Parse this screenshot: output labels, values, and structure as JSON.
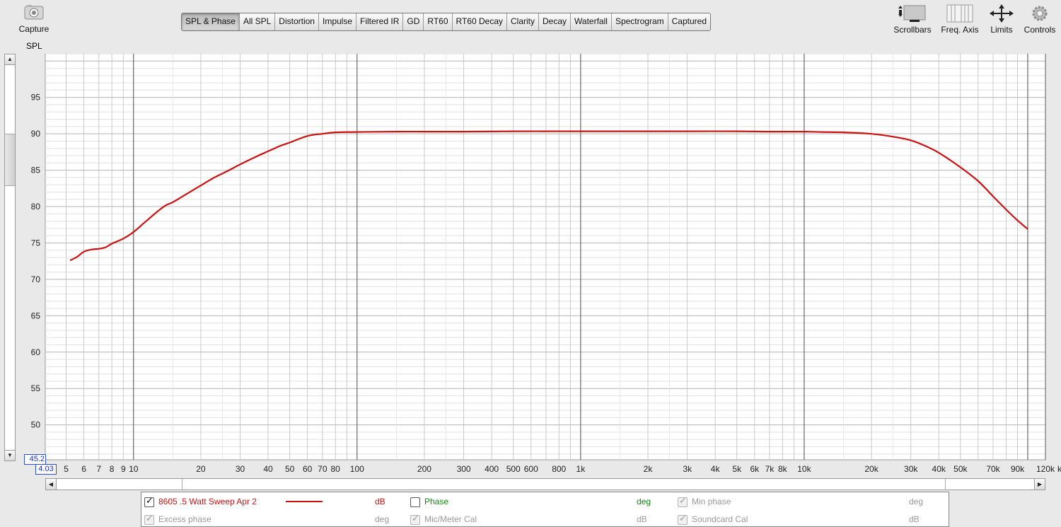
{
  "toolbar": {
    "capture": "Capture",
    "right_tools": [
      "Scrollbars",
      "Freq. Axis",
      "Limits",
      "Controls"
    ]
  },
  "tabs": [
    {
      "label": "SPL & Phase",
      "active": true
    },
    {
      "label": "All SPL",
      "active": false
    },
    {
      "label": "Distortion",
      "active": false
    },
    {
      "label": "Impulse",
      "active": false
    },
    {
      "label": "Filtered IR",
      "active": false
    },
    {
      "label": "GD",
      "active": false
    },
    {
      "label": "RT60",
      "active": false
    },
    {
      "label": "RT60 Decay",
      "active": false
    },
    {
      "label": "Clarity",
      "active": false
    },
    {
      "label": "Decay",
      "active": false
    },
    {
      "label": "Waterfall",
      "active": false
    },
    {
      "label": "Spectrogram",
      "active": false
    },
    {
      "label": "Captured",
      "active": false
    }
  ],
  "axis": {
    "y_label": "SPL",
    "y_min_box": "45.2",
    "x_min_box": "4.03",
    "x_unit": "Hz"
  },
  "legend": {
    "rows": [
      [
        {
          "label": "8605 .5 Watt Sweep Apr 2",
          "checked": true,
          "unit": "dB",
          "enabled": true,
          "color": "#cc1111",
          "line": true
        },
        {
          "label": "Phase",
          "checked": false,
          "unit": "deg",
          "enabled": true,
          "color": "#118811"
        },
        {
          "label": "Min phase",
          "checked": true,
          "unit": "deg",
          "enabled": false,
          "color": "#999999"
        }
      ],
      [
        {
          "label": "Excess phase",
          "checked": true,
          "unit": "deg",
          "enabled": false,
          "color": "#999999"
        },
        {
          "label": "Mic/Meter Cal",
          "checked": true,
          "unit": "dB",
          "enabled": false,
          "color": "#999999"
        },
        {
          "label": "Soundcard Cal",
          "checked": true,
          "unit": "dB",
          "enabled": false,
          "color": "#999999"
        }
      ]
    ]
  },
  "chart_data": {
    "type": "line",
    "xlabel": "kHz",
    "ylabel": "SPL",
    "x_scale": "log",
    "xlim": [
      4.03,
      120000
    ],
    "ylim": [
      45.2,
      101
    ],
    "grid": true,
    "y_ticks": [
      50,
      55,
      60,
      65,
      70,
      75,
      80,
      85,
      90,
      95
    ],
    "x_ticks": [
      {
        "v": 5,
        "t": "5"
      },
      {
        "v": 6,
        "t": "6"
      },
      {
        "v": 7,
        "t": "7"
      },
      {
        "v": 8,
        "t": "8"
      },
      {
        "v": 9,
        "t": "9"
      },
      {
        "v": 10,
        "t": "10"
      },
      {
        "v": 20,
        "t": "20"
      },
      {
        "v": 30,
        "t": "30"
      },
      {
        "v": 40,
        "t": "40"
      },
      {
        "v": 50,
        "t": "50"
      },
      {
        "v": 60,
        "t": "60"
      },
      {
        "v": 70,
        "t": "70"
      },
      {
        "v": 80,
        "t": "80"
      },
      {
        "v": 100,
        "t": "100"
      },
      {
        "v": 200,
        "t": "200"
      },
      {
        "v": 300,
        "t": "300"
      },
      {
        "v": 400,
        "t": "400"
      },
      {
        "v": 500,
        "t": "500"
      },
      {
        "v": 600,
        "t": "600"
      },
      {
        "v": 800,
        "t": "800"
      },
      {
        "v": 1000,
        "t": "1k"
      },
      {
        "v": 2000,
        "t": "2k"
      },
      {
        "v": 3000,
        "t": "3k"
      },
      {
        "v": 4000,
        "t": "4k"
      },
      {
        "v": 5000,
        "t": "5k"
      },
      {
        "v": 6000,
        "t": "6k"
      },
      {
        "v": 7000,
        "t": "7k"
      },
      {
        "v": 8000,
        "t": "8k"
      },
      {
        "v": 10000,
        "t": "10k"
      },
      {
        "v": 20000,
        "t": "20k"
      },
      {
        "v": 30000,
        "t": "30k"
      },
      {
        "v": 40000,
        "t": "40k"
      },
      {
        "v": 50000,
        "t": "50k"
      },
      {
        "v": 70000,
        "t": "70k"
      },
      {
        "v": 90000,
        "t": "90k"
      },
      {
        "v": 120000,
        "t": "120k"
      }
    ],
    "series": [
      {
        "name": "8605 .5 Watt Sweep Apr 2",
        "color": "#cc1111",
        "x": [
          5.2,
          5.6,
          6,
          6.5,
          7,
          7.5,
          8,
          9,
          10,
          11,
          12,
          13,
          14,
          15,
          17,
          20,
          23,
          26,
          30,
          35,
          40,
          45,
          50,
          55,
          60,
          65,
          70,
          80,
          100,
          150,
          200,
          300,
          500,
          1000,
          2000,
          3000,
          5000,
          7000,
          10000,
          12000,
          15000,
          20000,
          25000,
          30000,
          35000,
          40000,
          50000,
          60000,
          70000,
          80000,
          90000,
          100000
        ],
        "values": [
          72.6,
          73.1,
          73.8,
          74.1,
          74.2,
          74.4,
          74.9,
          75.6,
          76.5,
          77.6,
          78.6,
          79.5,
          80.2,
          80.6,
          81.6,
          82.9,
          84.0,
          84.8,
          85.8,
          86.8,
          87.6,
          88.3,
          88.8,
          89.3,
          89.7,
          89.9,
          90.0,
          90.2,
          90.25,
          90.3,
          90.3,
          90.3,
          90.35,
          90.35,
          90.35,
          90.35,
          90.35,
          90.3,
          90.3,
          90.25,
          90.2,
          90.0,
          89.6,
          89.1,
          88.3,
          87.4,
          85.4,
          83.5,
          81.4,
          79.6,
          78.1,
          76.9
        ]
      }
    ]
  }
}
